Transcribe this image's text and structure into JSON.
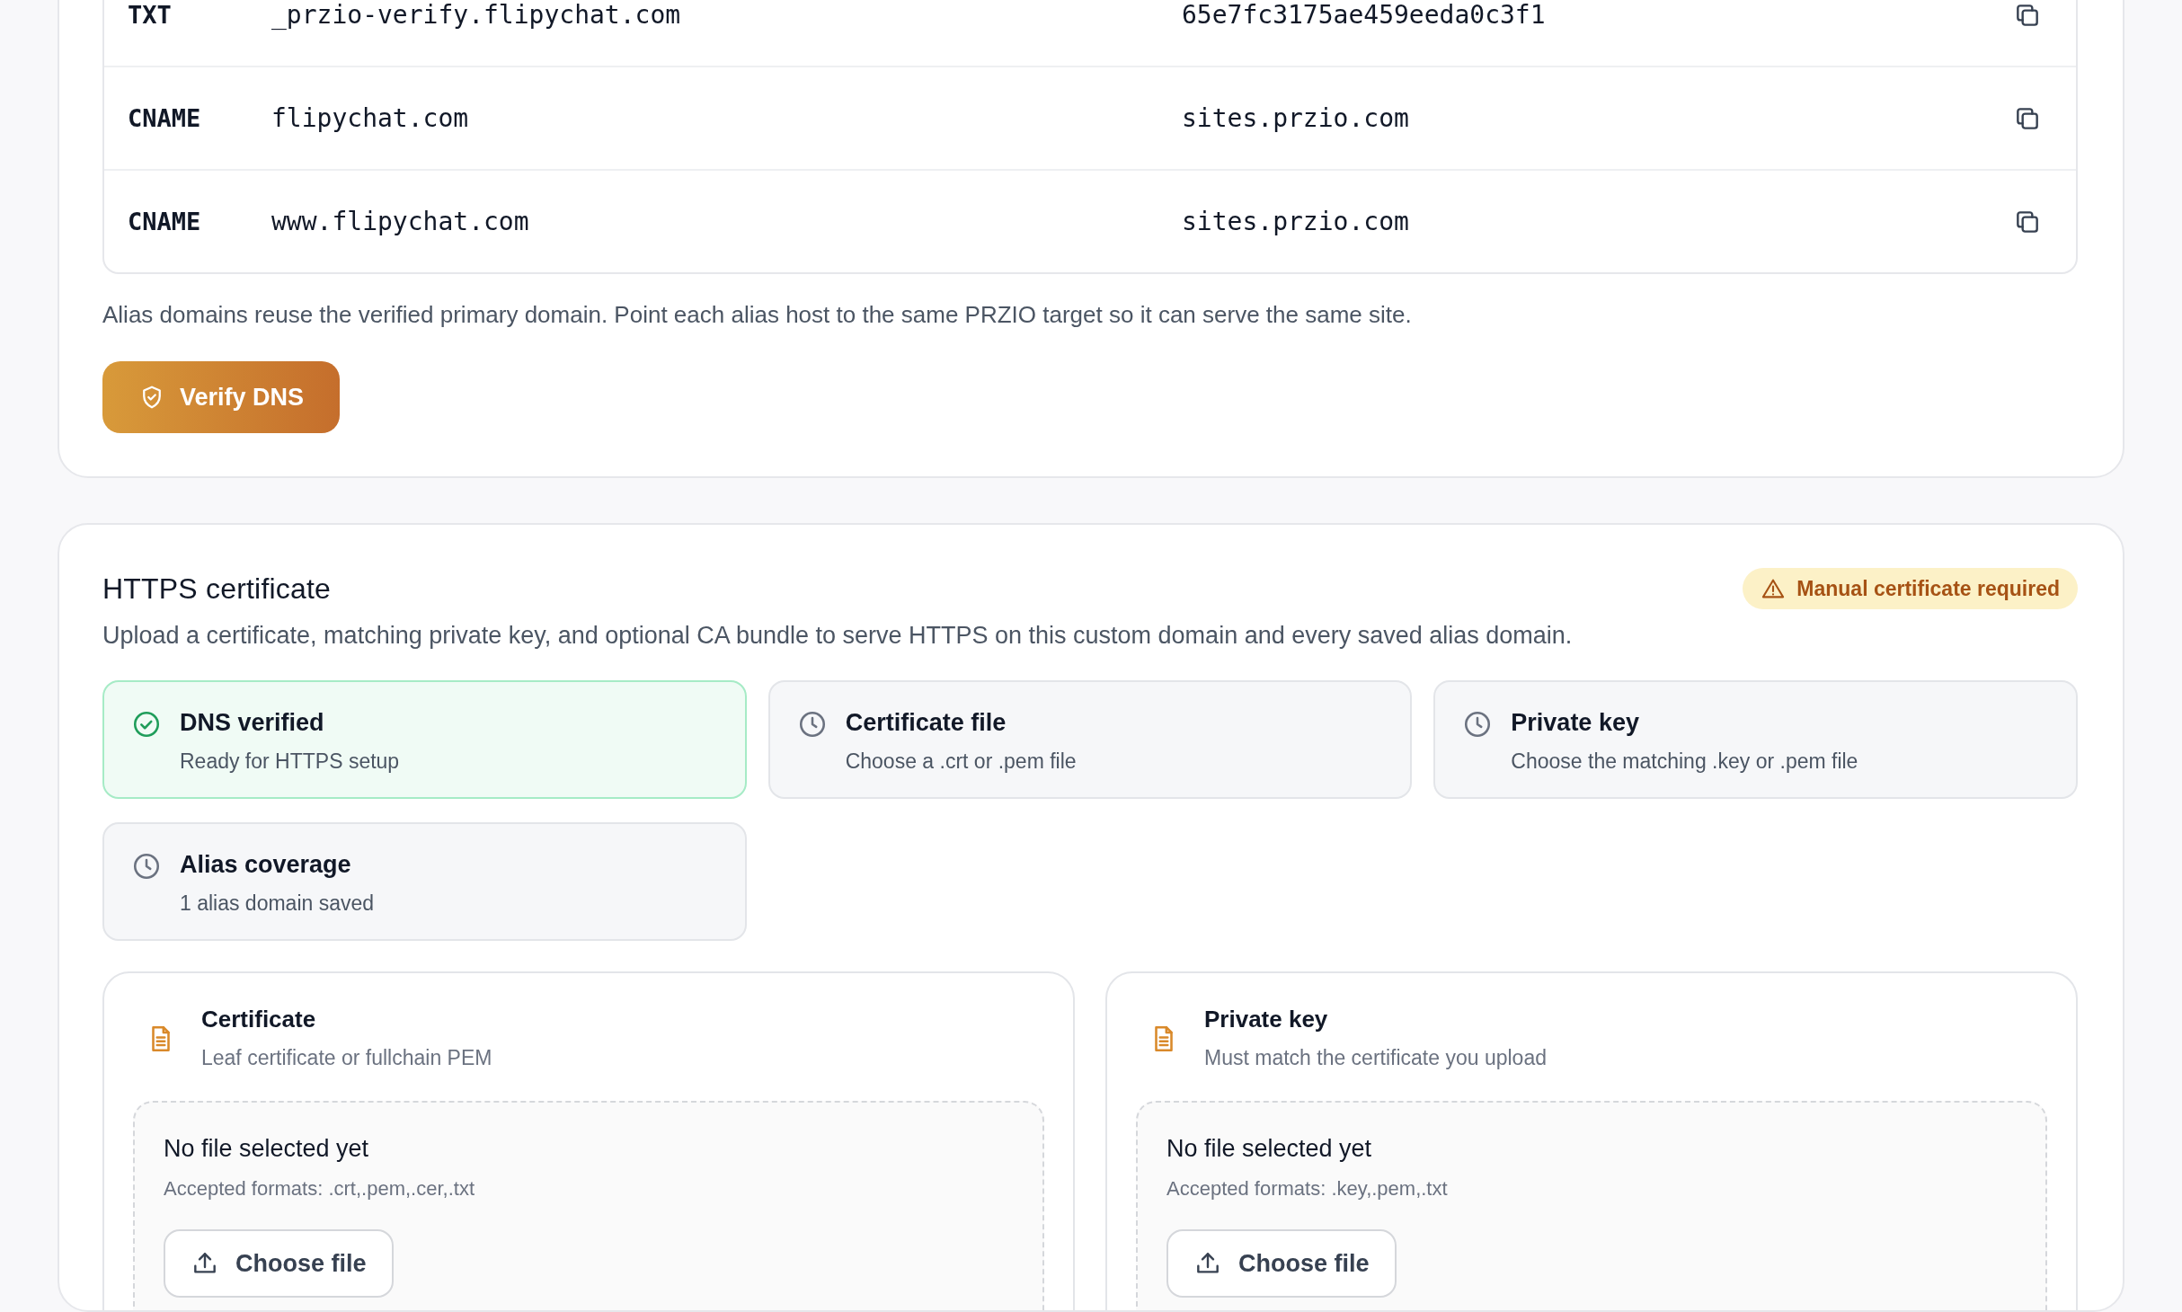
{
  "dns_records": {
    "rows": [
      {
        "type": "TXT",
        "host": "_przio-verify.flipychat.com",
        "value": "65e7fc3175ae459eeda0c3f1"
      },
      {
        "type": "CNAME",
        "host": "flipychat.com",
        "value": "sites.przio.com"
      },
      {
        "type": "CNAME",
        "host": "www.flipychat.com",
        "value": "sites.przio.com"
      }
    ],
    "note": "Alias domains reuse the verified primary domain. Point each alias host to the same PRZIO target so it can serve the same site.",
    "verify_button": {
      "label": "Verify DNS"
    }
  },
  "https_certificate": {
    "title": "HTTPS certificate",
    "badge": {
      "label": "Manual certificate required",
      "warning": true
    },
    "description": "Upload a certificate, matching private key, and optional CA bundle to serve HTTPS on this custom domain and every saved alias domain.",
    "check_rows": [
      {
        "items": [
          {
            "title": "DNS verified",
            "subtitle": "Ready for HTTPS setup",
            "done": true
          },
          {
            "title": "Certificate file",
            "subtitle": "Choose a .crt or .pem file",
            "done": false
          },
          {
            "title": "Private key",
            "subtitle": "Choose the matching .key or .pem file",
            "done": false
          }
        ]
      },
      {
        "items": [
          {
            "title": "Alias coverage",
            "subtitle": "1 alias domain saved",
            "done": false
          }
        ]
      }
    ],
    "uploads": [
      {
        "title": "Certificate",
        "subtitle": "Leaf certificate or fullchain PEM",
        "file_status": "No file selected yet",
        "formats": "Accepted formats: .crt,.pem,.cer,.txt",
        "button": "Choose file"
      },
      {
        "title": "Private key",
        "subtitle": "Must match the certificate you upload",
        "file_status": "No file selected yet",
        "formats": "Accepted formats: .key,.pem,.txt",
        "button": "Choose file"
      }
    ]
  }
}
